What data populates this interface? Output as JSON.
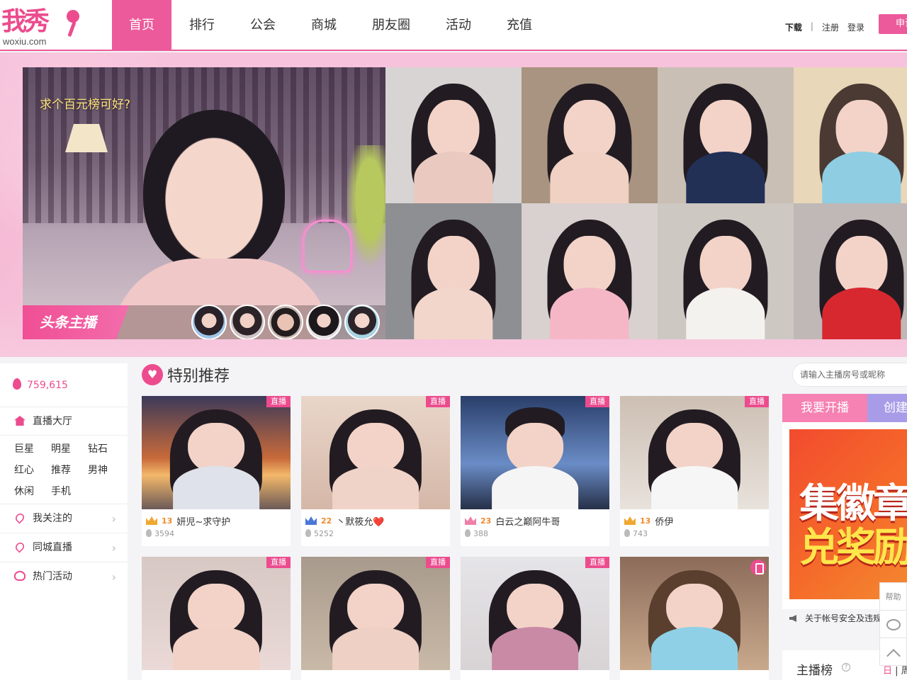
{
  "header": {
    "logo_mark": "我秀",
    "logo_domain": "woxiu.com",
    "nav": [
      "首页",
      "排行",
      "公会",
      "商城",
      "朋友圈",
      "活动",
      "充值"
    ],
    "download": "下载",
    "separator": "|",
    "register": "注册",
    "login": "登录",
    "apply_label": "申请"
  },
  "banner": {
    "hero_caption": "求个百元榜可好?",
    "hero_tag": "头条主播",
    "thumb_count": 5,
    "grid_count": 8
  },
  "sidebar": {
    "online_count": "759,615",
    "hall_label": "直播大厅",
    "categories": [
      "巨星",
      "明星",
      "钻石",
      "红心",
      "推荐",
      "男神",
      "休闲",
      "手机"
    ],
    "links": [
      {
        "label": "我关注的",
        "icon": "heart-plus-icon"
      },
      {
        "label": "同城直播",
        "icon": "location-pin-icon"
      },
      {
        "label": "热门活动",
        "icon": "flame-icon"
      }
    ]
  },
  "recommend": {
    "title": "特别推荐",
    "live_label": "直播",
    "cards": [
      {
        "level": "13",
        "name": "妍児~求守护",
        "viewers": "3594",
        "crown": "gold",
        "badge": "live"
      },
      {
        "level": "22",
        "name": "丶默筱允❤️",
        "viewers": "5252",
        "crown": "blue",
        "badge": "live"
      },
      {
        "level": "23",
        "name": "白云之巅阿牛哥",
        "viewers": "388",
        "crown": "pink",
        "badge": "live"
      },
      {
        "level": "13",
        "name": "侨伊",
        "viewers": "743",
        "crown": "gold",
        "badge": "live"
      },
      {
        "level": "",
        "name": "",
        "viewers": "",
        "crown": "none",
        "badge": "live"
      },
      {
        "level": "",
        "name": "",
        "viewers": "",
        "crown": "none",
        "badge": "live"
      },
      {
        "level": "",
        "name": "",
        "viewers": "",
        "crown": "none",
        "badge": "live"
      },
      {
        "level": "",
        "name": "",
        "viewers": "",
        "crown": "none",
        "badge": "phone"
      }
    ]
  },
  "right": {
    "search_placeholder": "请输入主播房号或昵称",
    "tab_start_live": "我要开播",
    "tab_create": "创建",
    "promo_line1": "集徽章",
    "promo_line2": "兑奖励",
    "notice": "关于帐号安全及违规",
    "rank_title": "主播榜",
    "rank_help": "?",
    "rank_day": "日",
    "rank_sep": "|",
    "rank_week": "周"
  },
  "float_bar": {
    "help": "帮助"
  },
  "colors": {
    "accent": "#ec5a9b",
    "banner_bg": "#f4b0cf",
    "promo_bg": "#f24b2e",
    "promo_highlight": "#ffe64b"
  }
}
